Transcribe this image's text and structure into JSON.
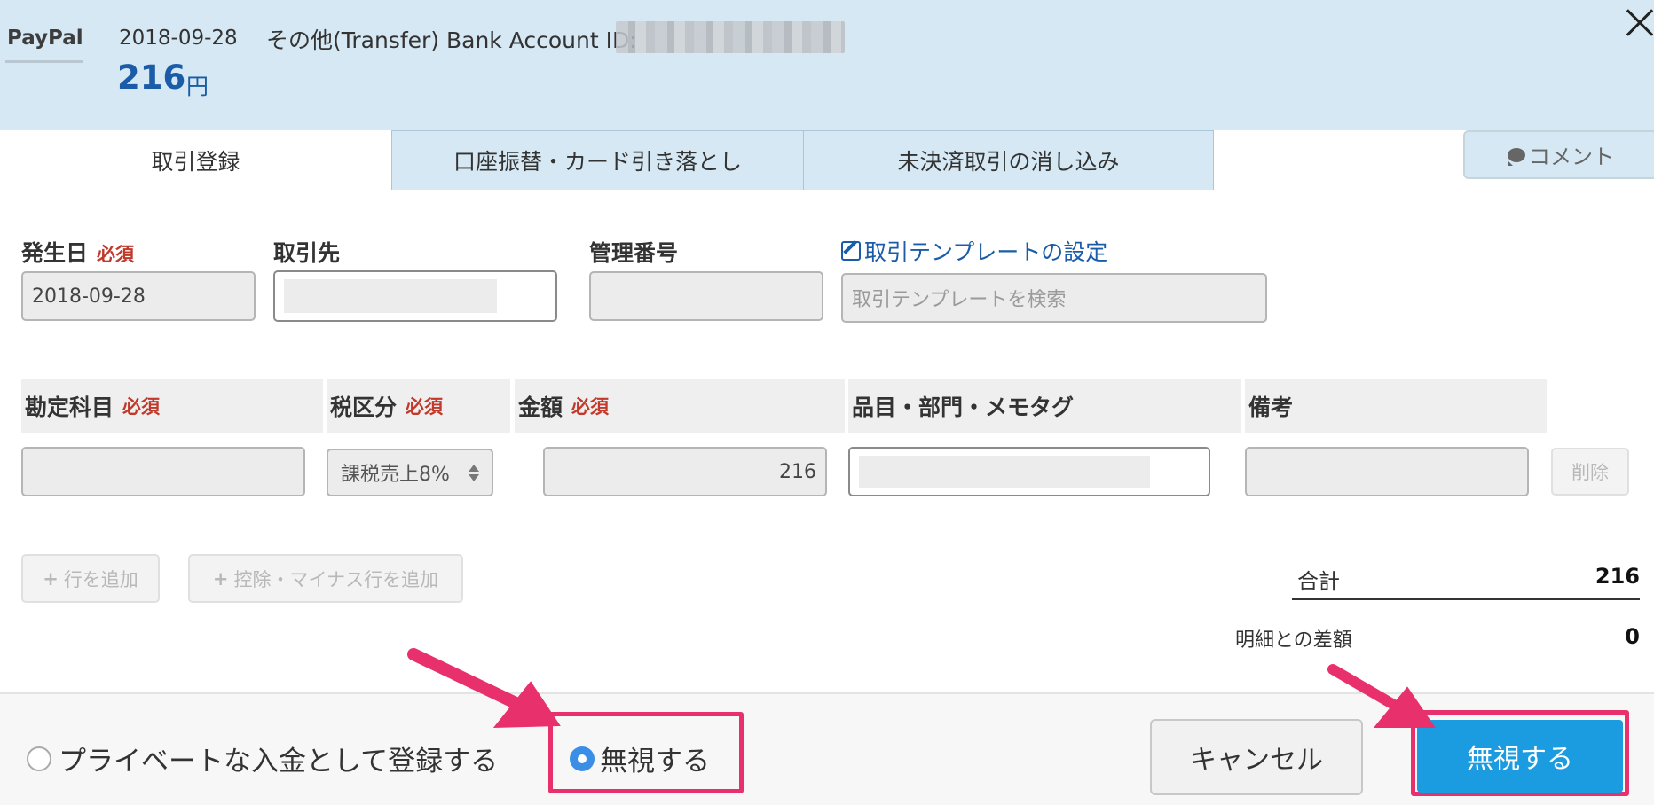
{
  "header": {
    "brand": "PayPal",
    "date": "2018-09-28",
    "description": "その他(Transfer) Bank Account ID:",
    "amount": "216",
    "unit": "円"
  },
  "tabs": [
    {
      "label": "取引登録",
      "active": true
    },
    {
      "label": "口座振替・カード引き落とし",
      "active": false
    },
    {
      "label": "未決済取引の消し込み",
      "active": false
    }
  ],
  "comment_button": "コメント",
  "form": {
    "date_label": "発生日",
    "required": "必須",
    "date_value": "2018-09-28",
    "partner_label": "取引先",
    "management_label": "管理番号",
    "template_link": "取引テンプレートの設定",
    "template_placeholder": "取引テンプレートを検索"
  },
  "table": {
    "headers": [
      {
        "label": "勘定科目",
        "required": true
      },
      {
        "label": "税区分",
        "required": true
      },
      {
        "label": "金額",
        "required": true
      },
      {
        "label": "品目・部門・メモタグ",
        "required": false
      },
      {
        "label": "備考",
        "required": false
      }
    ],
    "row": {
      "account": "",
      "tax": "課税売上8%",
      "amount": "216",
      "tags": "",
      "memo": "",
      "delete": "削除"
    }
  },
  "actions": {
    "add_row": "行を追加",
    "add_minus_row": "控除・マイナス行を追加"
  },
  "totals": {
    "total_label": "合計",
    "total_value": "216",
    "diff_label": "明細との差額",
    "diff_value": "0"
  },
  "footer": {
    "radio_private": "プライベートな入金として登録する",
    "radio_ignore": "無視する",
    "selected": "ignore",
    "cancel": "キャンセル",
    "submit": "無視する"
  },
  "colors": {
    "header_bg": "#d5e8f3",
    "accent": "#1a5ca8",
    "required": "#c0392b",
    "primary_button": "#1b9be0",
    "highlight": "#e8306c"
  }
}
